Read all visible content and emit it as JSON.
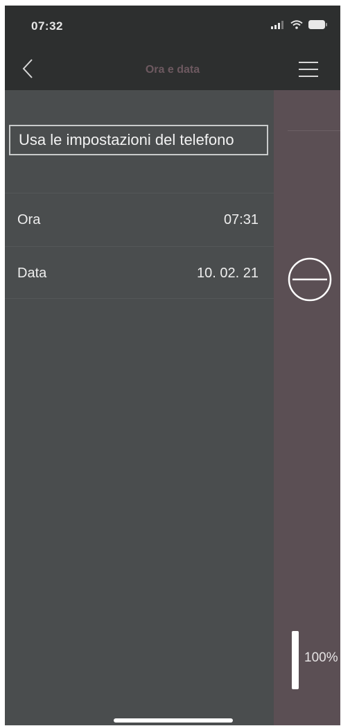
{
  "status_bar": {
    "time": "07:32"
  },
  "nav": {
    "title": "Ora e data",
    "title_color": "#6d5960"
  },
  "main": {
    "use_phone_settings_label": "Usa le impostazioni del telefono",
    "rows": [
      {
        "label": "Ora",
        "value": "07:31"
      },
      {
        "label": "Data",
        "value": "10. 02. 21"
      }
    ]
  },
  "side_panel": {
    "level_text": "100%",
    "level_fraction": 1.0,
    "accent_color": "#5b4f54"
  },
  "icons": {
    "back": "chevron-left-icon",
    "menu": "hamburger-menu-icon",
    "remove": "minus-circle-icon",
    "signal": "signal-icon",
    "wifi": "wifi-icon",
    "battery": "battery-icon"
  }
}
